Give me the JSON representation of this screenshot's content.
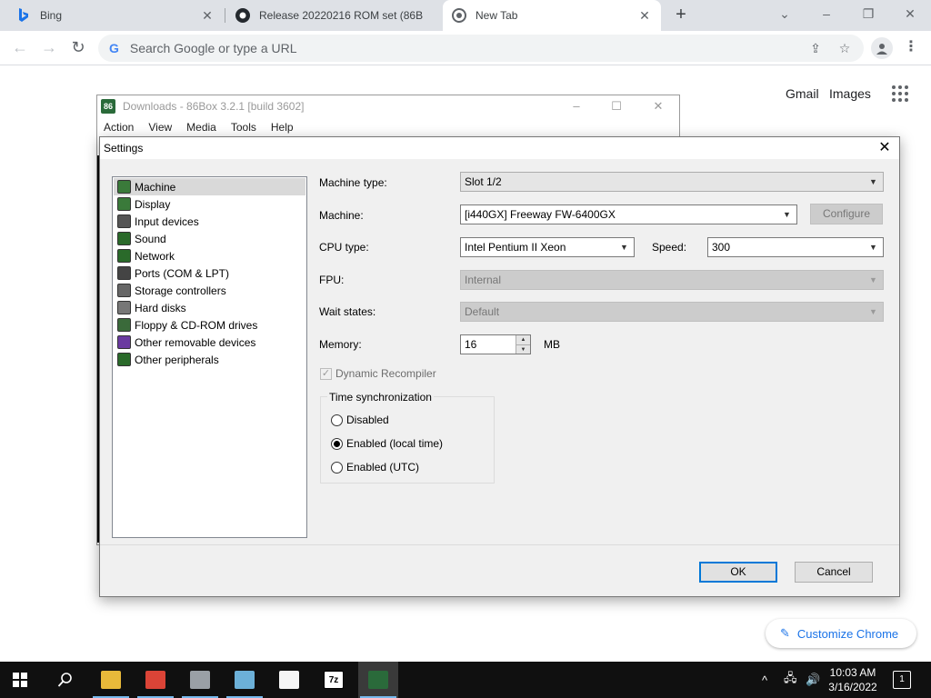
{
  "browser": {
    "tabs": [
      {
        "title": "Bing",
        "icon": "bing-icon"
      },
      {
        "title": "Release 20220216 ROM set (86B",
        "icon": "github-icon"
      },
      {
        "title": "New Tab",
        "icon": "chrome-icon"
      }
    ],
    "omnibox_placeholder": "Search Google or type a URL",
    "links": [
      "Gmail",
      "Images"
    ],
    "customize_label": "Customize Chrome"
  },
  "box_window": {
    "title": "Downloads - 86Box 3.2.1 [build 3602]",
    "menu": [
      "Action",
      "View",
      "Media",
      "Tools",
      "Help"
    ]
  },
  "settings": {
    "title": "Settings",
    "categories": [
      {
        "label": "Machine",
        "icon": "machine-icon",
        "color": "#3a7a3a"
      },
      {
        "label": "Display",
        "icon": "display-icon",
        "color": "#3a7a3a"
      },
      {
        "label": "Input devices",
        "icon": "input-devices-icon",
        "color": "#555555"
      },
      {
        "label": "Sound",
        "icon": "sound-icon",
        "color": "#2a6a2a"
      },
      {
        "label": "Network",
        "icon": "network-icon",
        "color": "#2a6a2a"
      },
      {
        "label": "Ports (COM & LPT)",
        "icon": "ports-icon",
        "color": "#444444"
      },
      {
        "label": "Storage controllers",
        "icon": "storage-controllers-icon",
        "color": "#666666"
      },
      {
        "label": "Hard disks",
        "icon": "hard-disk-icon",
        "color": "#777777"
      },
      {
        "label": "Floppy & CD-ROM drives",
        "icon": "floppy-icon",
        "color": "#3a6a3a"
      },
      {
        "label": "Other removable devices",
        "icon": "removable-devices-icon",
        "color": "#6a3aa0"
      },
      {
        "label": "Other peripherals",
        "icon": "peripherals-icon",
        "color": "#2a6a2a"
      }
    ],
    "selected_category": "Machine",
    "labels": {
      "machine_type": "Machine type:",
      "machine": "Machine:",
      "cpu_type": "CPU type:",
      "speed": "Speed:",
      "fpu": "FPU:",
      "wait_states": "Wait states:",
      "memory": "Memory:",
      "memory_unit": "MB"
    },
    "values": {
      "machine_type": "Slot 1/2",
      "machine": "[i440GX] Freeway FW-6400GX",
      "cpu_type": "Intel Pentium II Xeon",
      "speed": "300",
      "fpu": "Internal",
      "wait_states": "Default",
      "memory": "16"
    },
    "configure_label": "Configure",
    "dynamic_recompiler": "Dynamic Recompiler",
    "time_sync": {
      "title": "Time synchronization",
      "options": [
        "Disabled",
        "Enabled (local time)",
        "Enabled (UTC)"
      ],
      "selected": "Enabled (local time)"
    },
    "ok_label": "OK",
    "cancel_label": "Cancel"
  },
  "taskbar": {
    "time": "10:03 AM",
    "date": "3/16/2022",
    "notifications": "1",
    "apps": [
      {
        "icon": "file-explorer-icon",
        "color": "#e8b93a",
        "glyph": ""
      },
      {
        "icon": "chrome-icon",
        "color": "#db4437",
        "glyph": ""
      },
      {
        "icon": "paint-icon",
        "color": "#9aa0a6",
        "glyph": ""
      },
      {
        "icon": "notepad-icon",
        "color": "#6cb0d8",
        "glyph": ""
      },
      {
        "icon": "photos-icon",
        "color": "#f5f5f5",
        "glyph": ""
      },
      {
        "icon": "7zip-icon",
        "color": "#ffffff",
        "glyph": "7z"
      },
      {
        "icon": "86box-icon",
        "color": "#2a6a3a",
        "glyph": ""
      }
    ]
  }
}
